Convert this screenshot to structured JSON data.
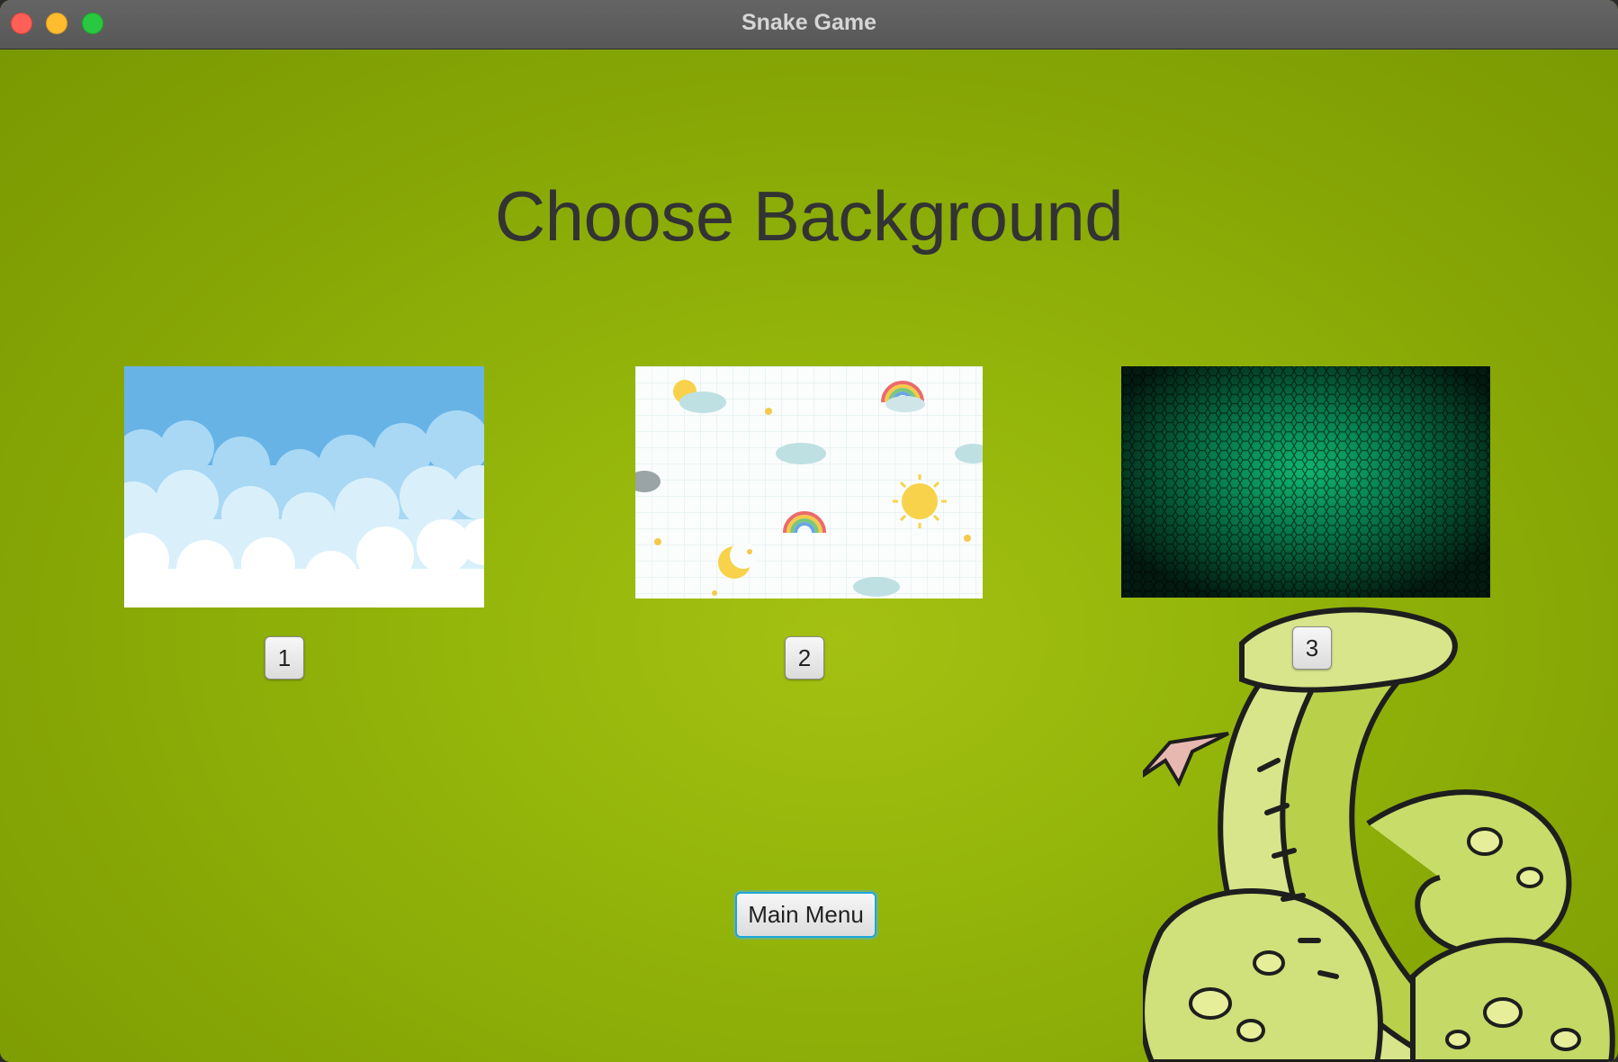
{
  "window": {
    "title": "Snake Game"
  },
  "screen": {
    "heading": "Choose Background",
    "options": [
      {
        "label": "1",
        "preview": "sky-clouds"
      },
      {
        "label": "2",
        "preview": "cute-sky-pattern"
      },
      {
        "label": "3",
        "preview": "green-hexagon-mesh"
      }
    ],
    "main_menu_label": "Main Menu"
  },
  "colors": {
    "background": "#8aa805",
    "heading": "#333333",
    "focus_ring": "#1ea6d9"
  }
}
